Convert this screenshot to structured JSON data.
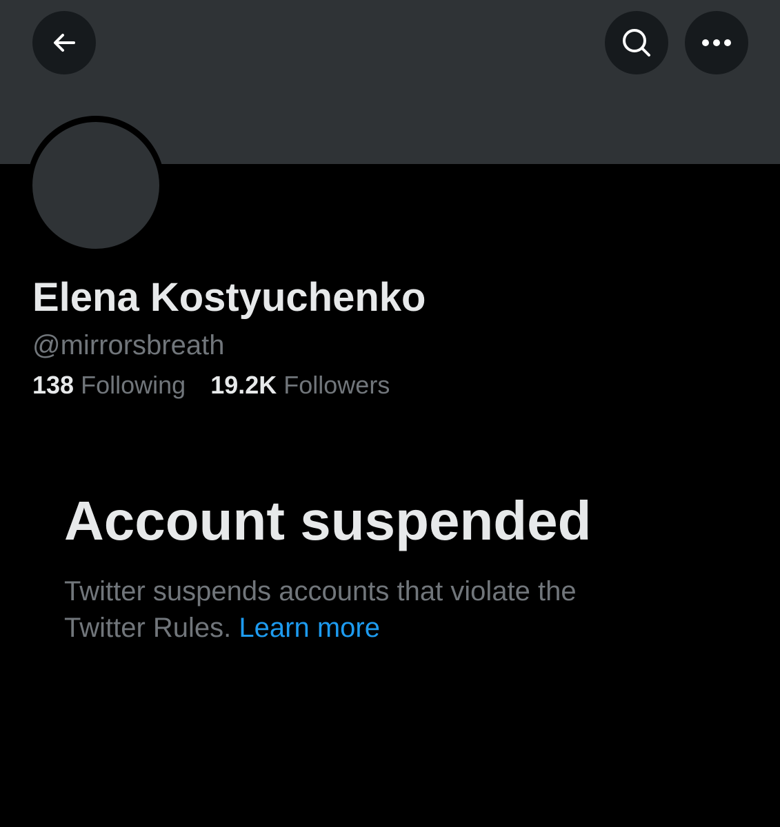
{
  "header": {
    "back_icon": "arrow-left-icon",
    "search_icon": "search-icon",
    "more_icon": "more-horizontal-icon"
  },
  "profile": {
    "display_name": "Elena Kostyuchenko",
    "handle": "@mirrorsbreath",
    "following_count": "138",
    "following_label": "Following",
    "followers_count": "19.2K",
    "followers_label": "Followers"
  },
  "notice": {
    "title": "Account suspended",
    "body": "Twitter suspends accounts that violate the Twitter Rules.",
    "link_label": "Learn more"
  },
  "colors": {
    "background": "#000000",
    "banner": "#2f3336",
    "text_primary": "#e7e9ea",
    "text_secondary": "#71767b",
    "link": "#1d9bf0"
  }
}
